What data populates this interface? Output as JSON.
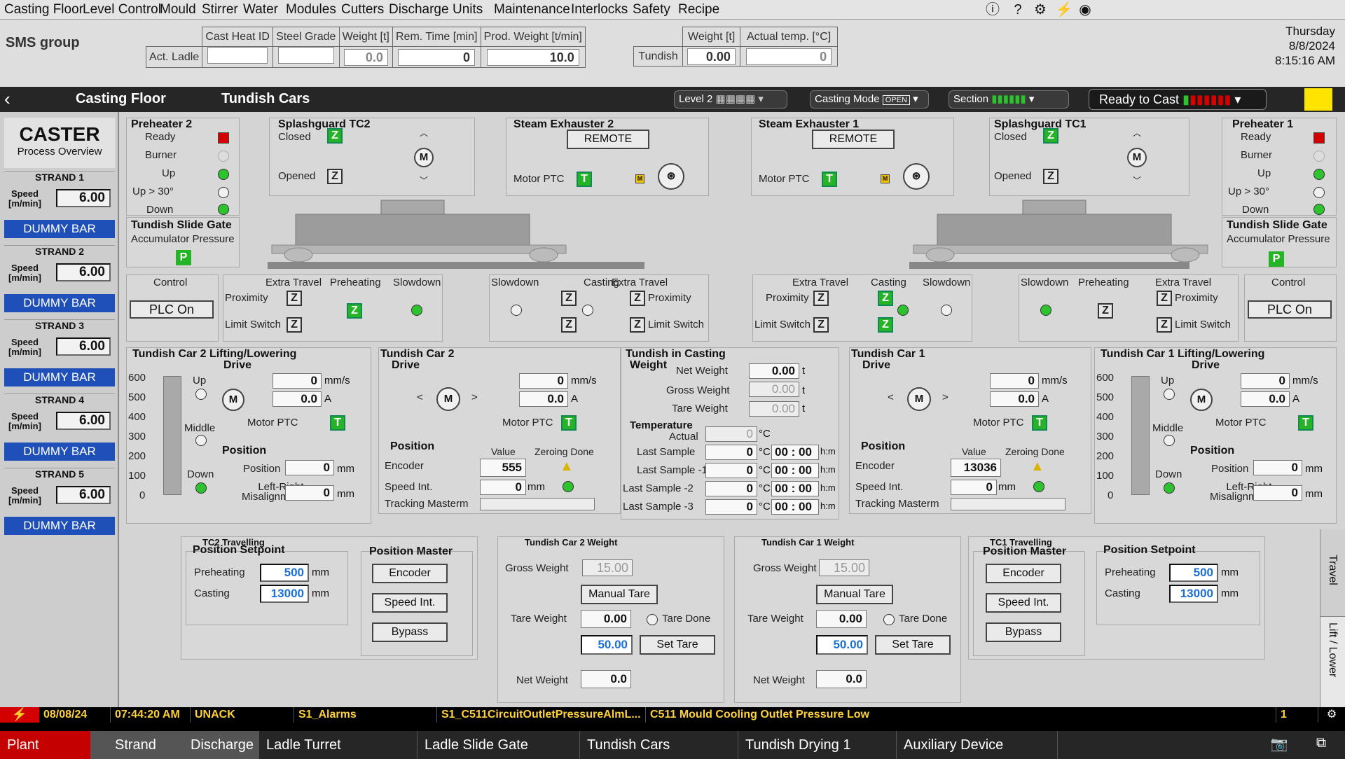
{
  "menu": [
    "Casting Floor",
    "Level Control",
    "Mould",
    "Stirrer",
    "Water",
    "Modules",
    "Cutters",
    "Discharge",
    "Units",
    "Maintenance",
    "Interlocks",
    "Safety",
    "Recipe"
  ],
  "logo": "SMS group",
  "header": {
    "ladle_cols": [
      "Cast Heat ID",
      "Steel Grade",
      "Weight [t]",
      "Rem. Time [min]",
      "Prod. Weight [t/min]"
    ],
    "ladle_label": "Act. Ladle",
    "ladle_vals": [
      "",
      "",
      "0.0",
      "0",
      "10.0"
    ],
    "tundish_cols": [
      "Weight [t]",
      "Actual temp. [°C]"
    ],
    "tundish_label": "Tundish",
    "tundish_vals": [
      "0.00",
      "0"
    ],
    "day": "Thursday",
    "date": "8/8/2024",
    "time": "8:15:16 AM"
  },
  "nav": {
    "crumb1": "Casting Floor",
    "crumb2": "Tundish Cars",
    "level": "Level 2",
    "casting_mode": "Casting Mode",
    "casting_mode_badge": "OPEN",
    "section": "Section",
    "ready": "Ready to Cast"
  },
  "sidebar": {
    "title": "CASTER",
    "subtitle": "Process Overview",
    "speed_label1": "Speed",
    "speed_label2": "[m/min]",
    "strands": [
      {
        "name": "STRAND 1",
        "speed": "6.00",
        "dummy": "DUMMY BAR"
      },
      {
        "name": "STRAND 2",
        "speed": "6.00",
        "dummy": "DUMMY BAR"
      },
      {
        "name": "STRAND 3",
        "speed": "6.00",
        "dummy": "DUMMY BAR"
      },
      {
        "name": "STRAND 4",
        "speed": "6.00",
        "dummy": "DUMMY BAR"
      },
      {
        "name": "STRAND 5",
        "speed": "6.00",
        "dummy": "DUMMY BAR"
      }
    ]
  },
  "pre2": {
    "title": "Preheater 2",
    "l1": "Ready",
    "l2": "Burner",
    "l3": "Up",
    "l4": "Up > 30°",
    "l5": "Down"
  },
  "pre1": {
    "title": "Preheater 1",
    "l1": "Ready",
    "l2": "Burner",
    "l3": "Up",
    "l4": "Up > 30°",
    "l5": "Down"
  },
  "sg2": {
    "title": "Splashguard TC2",
    "closed": "Closed",
    "opened": "Opened",
    "z": "Z",
    "m": "M"
  },
  "sg1": {
    "title": "Splashguard TC1",
    "closed": "Closed",
    "opened": "Opened",
    "z": "Z",
    "m": "M"
  },
  "se2": {
    "title": "Steam Exhauster 2",
    "remote": "REMOTE",
    "motor": "Motor PTC",
    "t": "T",
    "m": "M"
  },
  "se1": {
    "title": "Steam Exhauster 1",
    "remote": "REMOTE",
    "motor": "Motor PTC",
    "t": "T",
    "m": "M"
  },
  "tsg2": {
    "title": "Tundish Slide Gate",
    "sub": "Accumulator Pressure",
    "p": "P"
  },
  "tsg1": {
    "title": "Tundish Slide Gate",
    "sub": "Accumulator Pressure",
    "p": "P"
  },
  "ctrl2": {
    "title": "Control",
    "btn": "PLC On"
  },
  "ctrl1": {
    "title": "Control",
    "btn": "PLC On"
  },
  "pos_labels": {
    "extra": "Extra Travel",
    "preheat": "Preheating",
    "slow": "Slowdown",
    "casting": "Casting",
    "prox": "Proximity",
    "limit": "Limit Switch"
  },
  "lift2": {
    "title": "Tundish Car 2 Lifting/Lowering",
    "drive": "Drive",
    "up": "Up",
    "middle": "Middle",
    "down": "Down",
    "speed": "0",
    "current": "0.0",
    "u1": "mm/s",
    "u2": "A",
    "motor": "Motor PTC",
    "t": "T",
    "position": "Position",
    "pos_lbl": "Position",
    "pos": "0",
    "lr1": "Left-Right",
    "lr2": "Misalignment",
    "lr": "0",
    "mm": "mm",
    "scale": [
      "600",
      "500",
      "400",
      "300",
      "200",
      "100",
      "0"
    ]
  },
  "lift1": {
    "title": "Tundish Car 1 Lifting/Lowering",
    "drive": "Drive",
    "up": "Up",
    "middle": "Middle",
    "down": "Down",
    "speed": "0",
    "current": "0.0",
    "u1": "mm/s",
    "u2": "A",
    "motor": "Motor PTC",
    "t": "T",
    "position": "Position",
    "pos_lbl": "Position",
    "pos": "0",
    "lr1": "Left-Right",
    "lr2": "Misalignment",
    "lr": "0",
    "mm": "mm",
    "scale": [
      "600",
      "500",
      "400",
      "300",
      "200",
      "100",
      "0"
    ]
  },
  "car2": {
    "title": "Tundish Car 2",
    "drive": "Drive",
    "speed": "0",
    "current": "0.0",
    "u1": "mm/s",
    "u2": "A",
    "motor": "Motor PTC",
    "t": "T",
    "position": "Position",
    "value": "Value",
    "zero": "Zeroing Done",
    "encoder": "Encoder",
    "enc": "555",
    "speedint": "Speed Int.",
    "si": "0",
    "mm": "mm",
    "tracking": "Tracking Masterm"
  },
  "car1": {
    "title": "Tundish Car 1",
    "drive": "Drive",
    "speed": "0",
    "current": "0.0",
    "u1": "mm/s",
    "u2": "A",
    "motor": "Motor PTC",
    "t": "T",
    "position": "Position",
    "value": "Value",
    "zero": "Zeroing Done",
    "encoder": "Encoder",
    "enc": "13036",
    "speedint": "Speed Int.",
    "si": "0",
    "mm": "mm",
    "tracking": "Tracking Masterm"
  },
  "tic": {
    "title": "Tundish in Casting",
    "weight": "Weight",
    "net": "Net Weight",
    "gross": "Gross Weight",
    "tare": "Tare Weight",
    "netv": "0.00",
    "grossv": "0.00",
    "tarev": "0.00",
    "t": "t",
    "temp": "Temperature",
    "actual": "Actual",
    "actualv": "0",
    "c": "°C",
    "hm": "h:m",
    "samples": [
      {
        "l": "Last Sample",
        "v": "0",
        "t": "00 : 00"
      },
      {
        "l": "Last Sample -1",
        "v": "0",
        "t": "00 : 00"
      },
      {
        "l": "Last Sample -2",
        "v": "0",
        "t": "00 : 00"
      },
      {
        "l": "Last Sample -3",
        "v": "0",
        "t": "00 : 00"
      }
    ]
  },
  "tc2t": {
    "title": "TC2 Travelling",
    "ps": "Position Setpoint",
    "pre": "Preheating",
    "prev": "500",
    "cast": "Casting",
    "castv": "13000",
    "mm": "mm",
    "pm": "Position Master",
    "b1": "Encoder",
    "b2": "Speed Int.",
    "b3": "Bypass"
  },
  "tc1t": {
    "title": "TC1 Travelling",
    "ps": "Position Setpoint",
    "pre": "Preheating",
    "prev": "500",
    "cast": "Casting",
    "castv": "13000",
    "mm": "mm",
    "pm": "Position Master",
    "b1": "Encoder",
    "b2": "Speed Int.",
    "b3": "Bypass"
  },
  "w2": {
    "title": "Tundish Car 2 Weight",
    "gross": "Gross Weight",
    "grossv": "15.00",
    "manual": "Manual Tare",
    "tare": "Tare Weight",
    "tarev": "0.00",
    "tare_done": "Tare Done",
    "setv": "50.00",
    "set": "Set Tare",
    "net": "Net Weight",
    "netv": "0.0"
  },
  "w1": {
    "title": "Tundish Car 1 Weight",
    "gross": "Gross Weight",
    "grossv": "15.00",
    "manual": "Manual Tare",
    "tare": "Tare Weight",
    "tarev": "0.00",
    "tare_done": "Tare Done",
    "setv": "50.00",
    "set": "Set Tare",
    "net": "Net Weight",
    "netv": "0.0"
  },
  "side_tabs": {
    "travel": "Travel",
    "lift": "Lift / Lower"
  },
  "alarm": {
    "date": "08/08/24",
    "time": "07:44:20 AM",
    "state": "UNACK",
    "group": "S1_Alarms",
    "tag": "S1_C511CircuitOutletPressureAlmL...",
    "msg": "C511 Mould Cooling Outlet Pressure Low",
    "count": "1"
  },
  "bottom_nav": [
    "Plant",
    "Strand",
    "Discharge",
    "Ladle Turret",
    "Ladle Slide Gate",
    "Tundish Cars",
    "Tundish Drying 1",
    "Auxiliary Device"
  ],
  "colors": {
    "green": "#25b425",
    "red": "#d40000",
    "blue": "#1f4fb8",
    "yellow": "#ffd23a"
  }
}
